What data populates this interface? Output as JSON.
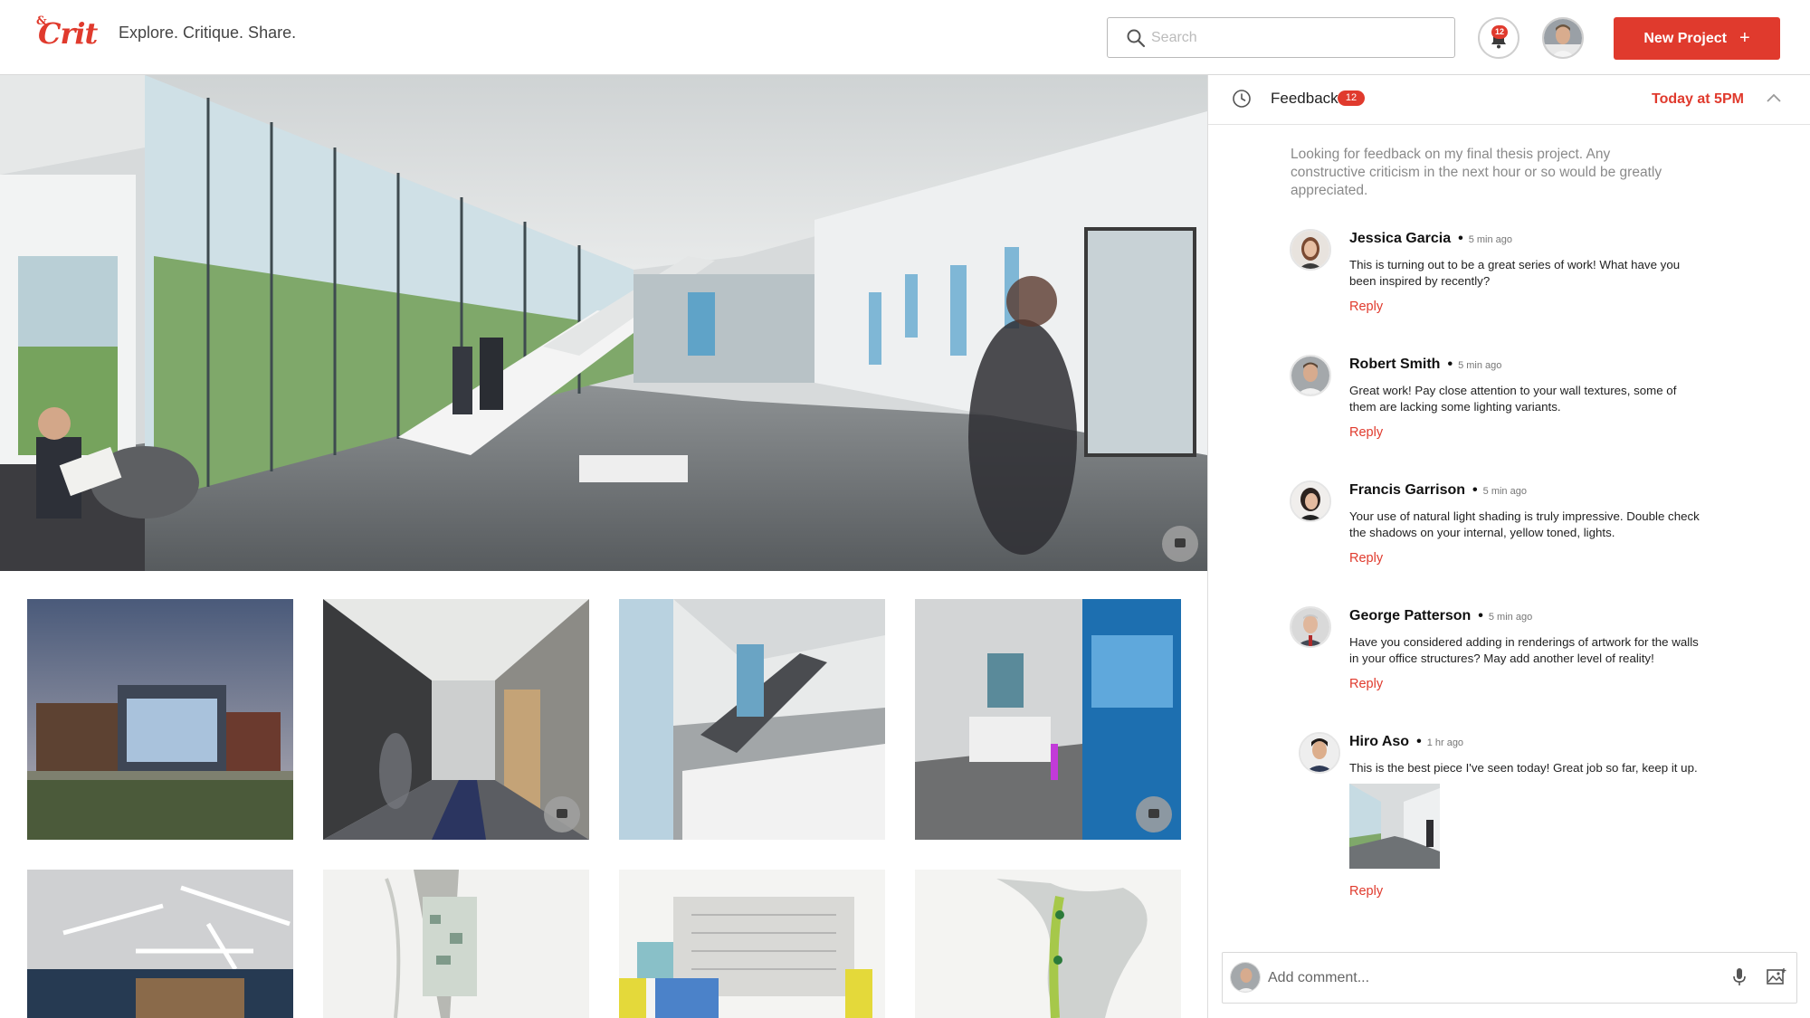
{
  "header": {
    "logo_amp": "&",
    "logo_text": "Crit",
    "tagline": "Explore. Critique. Share.",
    "search_placeholder": "Search",
    "search_value": "",
    "notification_count": "12",
    "new_project_label": "New Project",
    "new_project_icon": "plus-icon",
    "accent_color": "#e03a2d"
  },
  "gallery": {
    "hero_alt": "Office lobby interior rendering",
    "thumbnails": [
      {
        "label": "Exterior dusk rendering"
      },
      {
        "label": "Office corridor rendering"
      },
      {
        "label": "Atrium stair rendering"
      },
      {
        "label": "Blue glass lobby rendering"
      },
      {
        "label": "Open office ceiling rendering"
      },
      {
        "label": "Urban master plan"
      },
      {
        "label": "Site plan with parking"
      },
      {
        "label": "Greenway trail map"
      }
    ]
  },
  "feedback": {
    "title": "Feedback",
    "count": "12",
    "due": "Today at 5PM",
    "description": "Looking for feedback on my final thesis project. Any constructive criticism in the next hour or so would be greatly appreciated.",
    "reply_label": "Reply",
    "comments": [
      {
        "name": "Jessica Garcia",
        "time": "5 min ago",
        "text": "This is turning out to be a great series of work!  What have you been inspired by recently?"
      },
      {
        "name": "Robert Smith",
        "time": "5 min ago",
        "text": "Great work! Pay close attention to your wall textures, some of them are lacking some lighting variants."
      },
      {
        "name": "Francis Garrison",
        "time": "5 min ago",
        "text": "Your use of natural light shading is truly impressive. Double check the shadows on your internal, yellow toned, lights."
      },
      {
        "name": "George Patterson",
        "time": "5 min ago",
        "text": "Have you considered adding in renderings of artwork for the walls in your office structures? May add another level of reality!"
      },
      {
        "name": "Hiro Aso",
        "time": "1 hr ago",
        "text": "This is the best piece I've seen today! Great job so far, keep it up."
      }
    ],
    "add_comment_placeholder": "Add comment..."
  }
}
